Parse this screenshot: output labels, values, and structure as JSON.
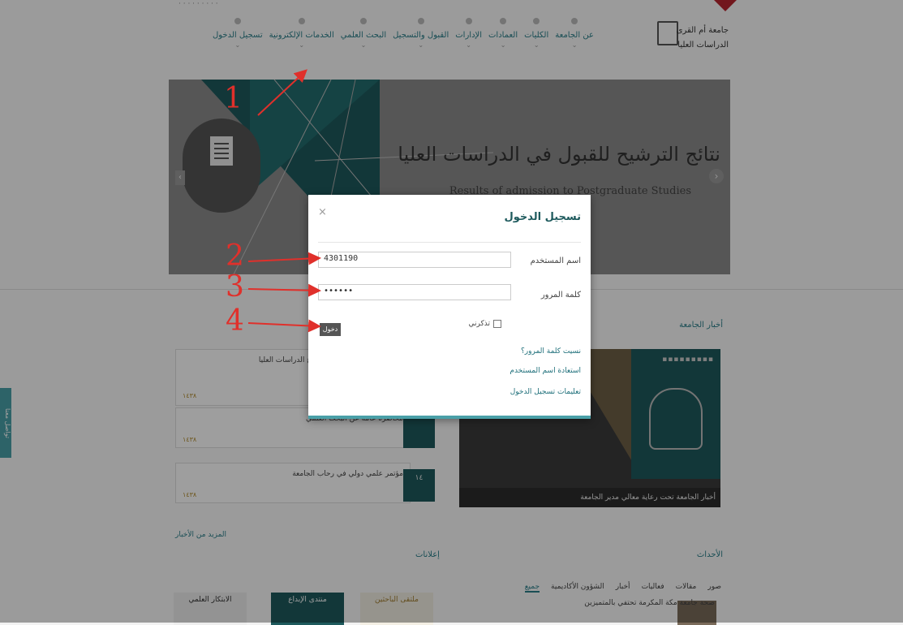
{
  "top": {
    "faint_text": "· · · · · · · · ·"
  },
  "logo": {
    "line1": "جامعة أم القرى",
    "line2": "الدراسات العليا"
  },
  "nav": {
    "items": [
      {
        "label": "عن الجامعة",
        "icon": "home-icon"
      },
      {
        "label": "الكليات",
        "icon": "building-icon"
      },
      {
        "label": "العمادات",
        "icon": "book-icon"
      },
      {
        "label": "الإدارات",
        "icon": "people-icon"
      },
      {
        "label": "القبول والتسجيل",
        "icon": "calendar-icon"
      },
      {
        "label": "البحث العلمي",
        "icon": "flask-icon"
      },
      {
        "label": "الخدمات الإلكترونية",
        "icon": "person-icon"
      },
      {
        "label": "تسجيل الدخول",
        "icon": "lock-icon"
      }
    ]
  },
  "banner": {
    "title": "نتائج الترشيح للقبول في الدراسات العليا",
    "subtitle": "Results of admission to Postgraduate Studies"
  },
  "content": {
    "feature_heading": "أخبار الجامعة",
    "feature_caption": "أخبار الجامعة تحت رعاية معالي مدير الجامعة",
    "feature_boxes": "▪▪▪▪▪▪▪▪▪",
    "news": [
      {
        "title": "إعلان عن نتائج القبول في برامج الدراسات العليا",
        "date": "١٤٣٨"
      },
      {
        "title": "محاضرة عامة عن البحث العلمي",
        "date": "١٤٣٨"
      },
      {
        "title": "مؤتمر علمي دولي في رحاب الجامعة",
        "date": "١٤٣٨"
      }
    ],
    "more_news": "المزيد من الأخبار",
    "events_heading": "الأحداث",
    "left_heading": "إعلانات",
    "tabs": [
      "جميع",
      "الشؤون الأكاديمية",
      "أخبار",
      "فعاليات",
      "مقالات",
      "صور"
    ],
    "tiles": [
      "الابتكار العلمي",
      "منتدى الإبداع",
      "ملتقى الباحثين"
    ],
    "news_item": "صحة جامعة مكة المكرمة تحتفي بالمتميزين"
  },
  "side_badge": "تواصل معنا",
  "modal": {
    "title": "تسجيل الدخول",
    "close": "×",
    "username_label": "اسم المستخدم",
    "username_value": "4301190",
    "password_label": "كلمة المرور",
    "password_value": "••••••",
    "remember_label": "تذكرني",
    "send_label": "دخول",
    "links": [
      "نسيت كلمة المرور؟",
      "استعادة اسم المستخدم",
      "تعليمات تسجيل الدخول"
    ]
  },
  "annotations": [
    "1",
    "2",
    "3",
    "4"
  ],
  "colors": {
    "accent": "#1e5a5d",
    "annotation": "#e0302b",
    "link": "#2a7f8a"
  }
}
